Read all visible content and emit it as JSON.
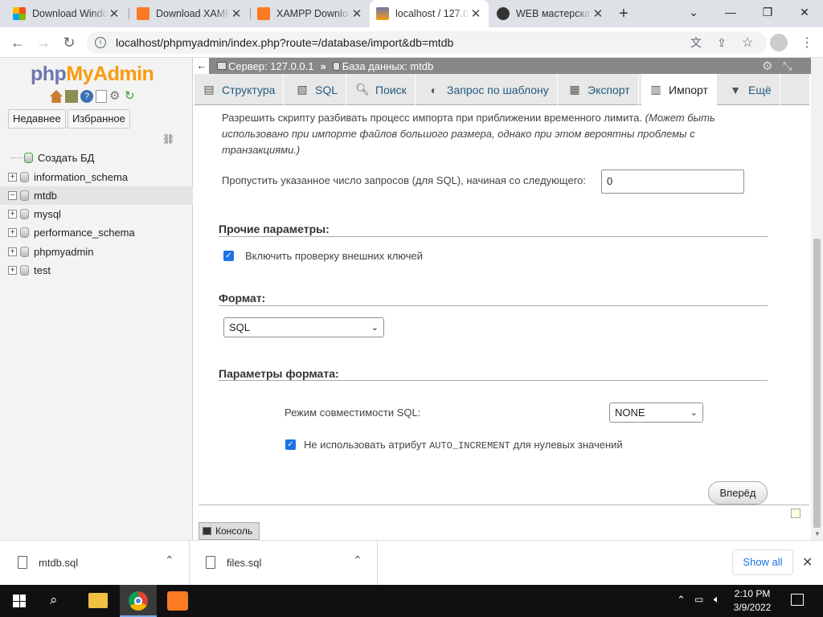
{
  "browser": {
    "tabs": [
      {
        "title": "Download Windo",
        "favicon_color": "#f25022"
      },
      {
        "title": "Download XAMP",
        "favicon_color": "#fb7a24"
      },
      {
        "title": "XAMPP Downloa",
        "favicon_color": "#fb7a24"
      },
      {
        "title": "localhost / 127.0",
        "favicon_color": "#6c78af"
      },
      {
        "title": "WEB мастерска",
        "favicon_color": "#333333"
      }
    ],
    "new_tab": "+",
    "url": "localhost/phpmyadmin/index.php?route=/database/import&db=mtdb"
  },
  "pma": {
    "logo_a": "php",
    "logo_b": "MyAdmin",
    "recent_label": "Недавнее",
    "favorites_label": "Избранное",
    "tree": [
      {
        "label": "Создать БД",
        "kind": "new"
      },
      {
        "label": "information_schema",
        "kind": "db"
      },
      {
        "label": "mtdb",
        "kind": "db",
        "selected": true
      },
      {
        "label": "mysql",
        "kind": "db"
      },
      {
        "label": "performance_schema",
        "kind": "db"
      },
      {
        "label": "phpmyadmin",
        "kind": "db"
      },
      {
        "label": "test",
        "kind": "db"
      }
    ],
    "breadcrumb": {
      "server": "Сервер: 127.0.0.1",
      "sep": "»",
      "database": "База данных: mtdb"
    },
    "menu": [
      {
        "label": "Структура",
        "icon": "structure-icon"
      },
      {
        "label": "SQL",
        "icon": "sql-icon"
      },
      {
        "label": "Поиск",
        "icon": "search-icon"
      },
      {
        "label": "Запрос по шаблону",
        "icon": "query-icon"
      },
      {
        "label": "Экспорт",
        "icon": "export-icon"
      },
      {
        "label": "Импорт",
        "icon": "import-icon",
        "active": true
      },
      {
        "label": "Ещё",
        "icon": "more-icon"
      }
    ],
    "content": {
      "partial_text": "Разрешить скрипту разбивать процесс импорта при приближении временного лимита.",
      "partial_note": "(Может быть использовано при импорте файлов большого размера, однако при этом вероятны проблемы с транзакциями.)",
      "skip_label": "Пропустить указанное число запросов (для SQL), начиная со следующего:",
      "skip_value": "0",
      "other_title": "Прочие параметры:",
      "fk_label": "Включить проверку внешних ключей",
      "format_title": "Формат:",
      "format_value": "SQL",
      "format_params_title": "Параметры формата:",
      "compat_label": "Режим совместимости SQL:",
      "compat_value": "NONE",
      "ai_label_pre": "Не использовать атрибут",
      "ai_code": "AUTO_INCREMENT",
      "ai_label_post": "для нулевых значений",
      "submit": "Вперёд",
      "console": "Консоль"
    }
  },
  "downloads": {
    "items": [
      "mtdb.sql",
      "files.sql"
    ],
    "show_all": "Show all"
  },
  "taskbar": {
    "time": "2:10 PM",
    "date": "3/9/2022"
  }
}
